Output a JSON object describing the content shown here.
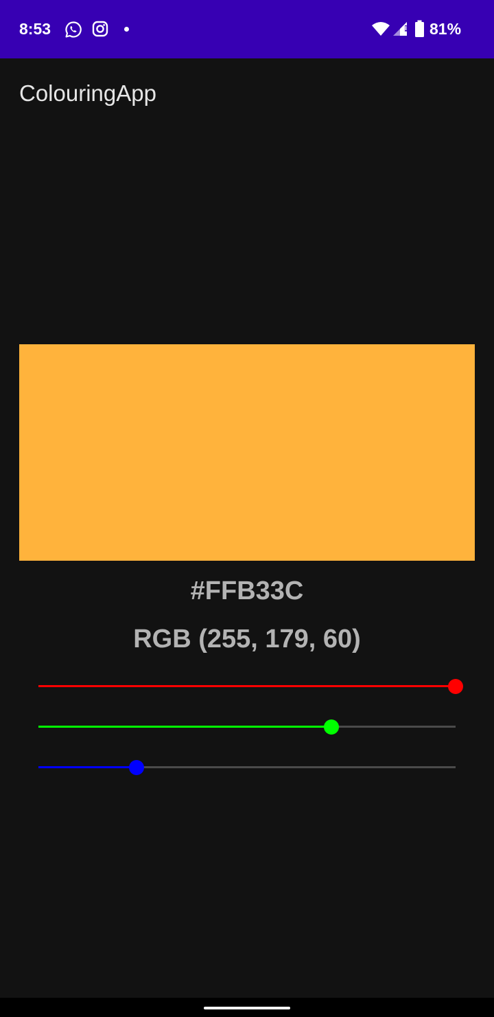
{
  "status_bar": {
    "time": "8:53",
    "battery": "81%",
    "background": "#3700b3",
    "notification_icons": [
      "whatsapp-icon",
      "instagram-icon",
      "dot-icon"
    ],
    "system_icons": [
      "wifi-icon",
      "signal-icon",
      "battery-icon"
    ]
  },
  "app": {
    "title": "ColouringApp"
  },
  "color": {
    "swatch": "#FFB33C",
    "hex": "#FFB33C",
    "rgb_label": "RGB (255, 179, 60)"
  },
  "sliders": [
    {
      "name": "red",
      "value": 255,
      "max": 255,
      "color": "#ff0000"
    },
    {
      "name": "green",
      "value": 179,
      "max": 255,
      "color": "#00ff00"
    },
    {
      "name": "blue",
      "value": 60,
      "max": 255,
      "color": "#0000ff"
    }
  ]
}
